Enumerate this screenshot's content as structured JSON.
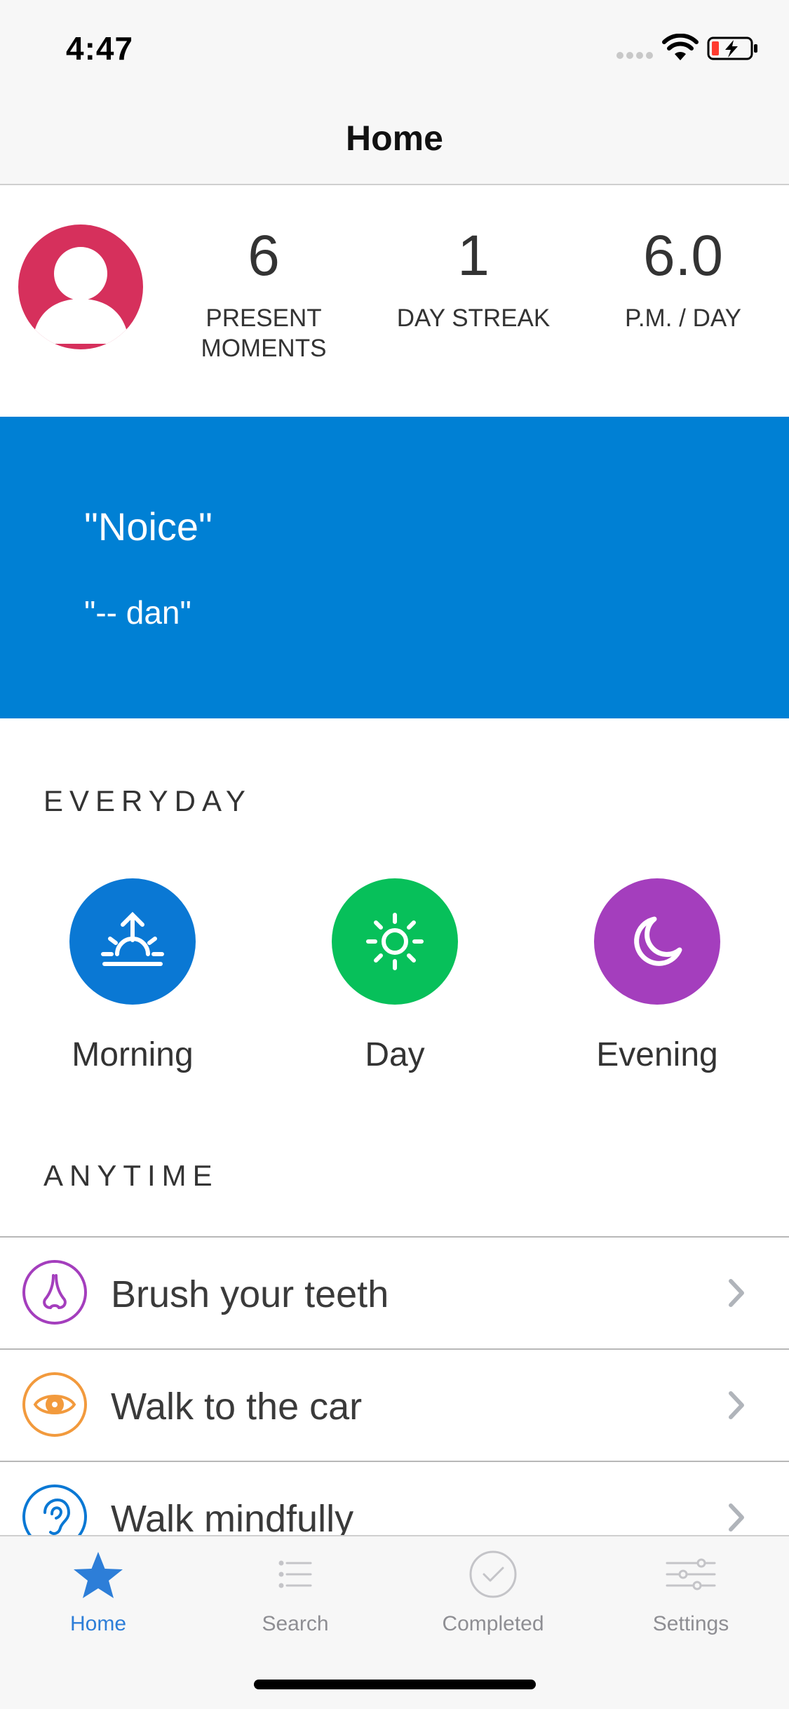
{
  "status_bar": {
    "time": "4:47"
  },
  "nav": {
    "title": "Home"
  },
  "profile": {
    "stats": [
      {
        "value": "6",
        "label_line1": "PRESENT",
        "label_line2": "MOMENTS"
      },
      {
        "value": "1",
        "label_line1": "DAY STREAK",
        "label_line2": ""
      },
      {
        "value": "6.0",
        "label_line1": "P.M. / DAY",
        "label_line2": ""
      }
    ]
  },
  "quote": {
    "text": "\"Noice\"",
    "author": "\"-- dan\""
  },
  "everyday": {
    "header": "EVERYDAY",
    "items": [
      {
        "label": "Morning",
        "icon": "sunrise-icon",
        "color": "#0a78d4"
      },
      {
        "label": "Day",
        "icon": "sun-icon",
        "color": "#07c05a"
      },
      {
        "label": "Evening",
        "icon": "moon-icon",
        "color": "#a43ebd"
      }
    ]
  },
  "anytime": {
    "header": "ANYTIME",
    "items": [
      {
        "label": "Brush your teeth",
        "icon": "nose-icon",
        "color": "#a43ebd"
      },
      {
        "label": "Walk to the car",
        "icon": "eye-icon",
        "color": "#f29a3d"
      },
      {
        "label": "Walk mindfully",
        "icon": "ear-icon",
        "color": "#0a78d4"
      }
    ]
  },
  "tabs": [
    {
      "label": "Home",
      "icon": "star-icon",
      "active": true
    },
    {
      "label": "Search",
      "icon": "list-icon",
      "active": false
    },
    {
      "label": "Completed",
      "icon": "checkmark-circle-icon",
      "active": false
    },
    {
      "label": "Settings",
      "icon": "sliders-icon",
      "active": false
    }
  ],
  "colors": {
    "accent": "#2d7ed8",
    "quote_bg": "#0080d4",
    "avatar_bg": "#d6305c"
  }
}
